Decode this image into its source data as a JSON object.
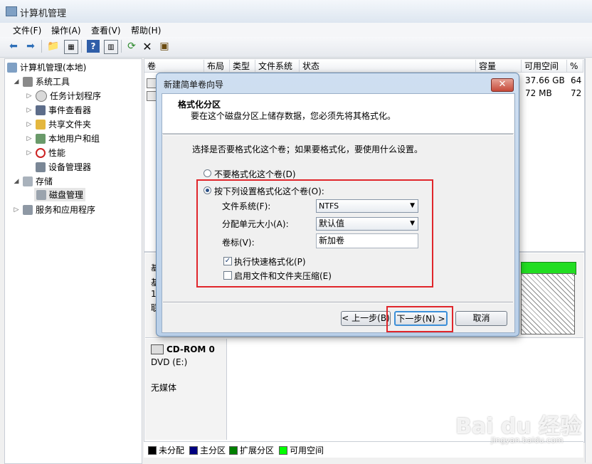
{
  "window": {
    "title": "计算机管理"
  },
  "menu": [
    "文件(F)",
    "操作(A)",
    "查看(V)",
    "帮助(H)"
  ],
  "tree": {
    "root": "计算机管理(本地)",
    "system_tools": "系统工具",
    "task_scheduler": "任务计划程序",
    "event_viewer": "事件查看器",
    "shared_folders": "共享文件夹",
    "local_users": "本地用户和组",
    "performance": "性能",
    "device_manager": "设备管理器",
    "storage": "存储",
    "disk_management": "磁盘管理",
    "services_apps": "服务和应用程序"
  },
  "volume_table": {
    "columns": [
      "卷",
      "布局",
      "类型",
      "文件系统",
      "状态",
      "容量",
      "可用空间",
      "%"
    ],
    "rows": [
      {
        "free": "37.66 GB",
        "pct": "64"
      },
      {
        "free": "72 MB",
        "pct": "72"
      }
    ]
  },
  "disk_view": {
    "partial_labels": [
      "基",
      "1",
      "联"
    ],
    "cdrom_title": "CD-ROM 0",
    "cdrom_drive": "DVD (E:)",
    "cdrom_media": "无媒体"
  },
  "legend": [
    {
      "label": "未分配",
      "color": "#000000"
    },
    {
      "label": "主分区",
      "color": "#000080"
    },
    {
      "label": "扩展分区",
      "color": "#008000"
    },
    {
      "label": "可用空间",
      "color": "#00ff00"
    }
  ],
  "dialog": {
    "title": "新建简单卷向导",
    "header_title": "格式化分区",
    "header_subtitle": "要在这个磁盘分区上储存数据，您必须先将其格式化。",
    "instruction": "选择是否要格式化这个卷；如果要格式化，要使用什么设置。",
    "opt_no_format": "不要格式化这个卷(D)",
    "opt_format": "按下列设置格式化这个卷(O):",
    "fs_label": "文件系统(F):",
    "fs_value": "NTFS",
    "alloc_label": "分配单元大小(A):",
    "alloc_value": "默认值",
    "vol_label": "卷标(V):",
    "vol_value": "新加卷",
    "quick_format": "执行快速格式化(P)",
    "compression": "启用文件和文件夹压缩(E)",
    "btn_back": "< 上一步(B)",
    "btn_next": "下一步(N) >",
    "btn_cancel": "取消"
  },
  "watermark": {
    "brand": "Bai du 经验",
    "url": "jingyan.baidu.com"
  }
}
